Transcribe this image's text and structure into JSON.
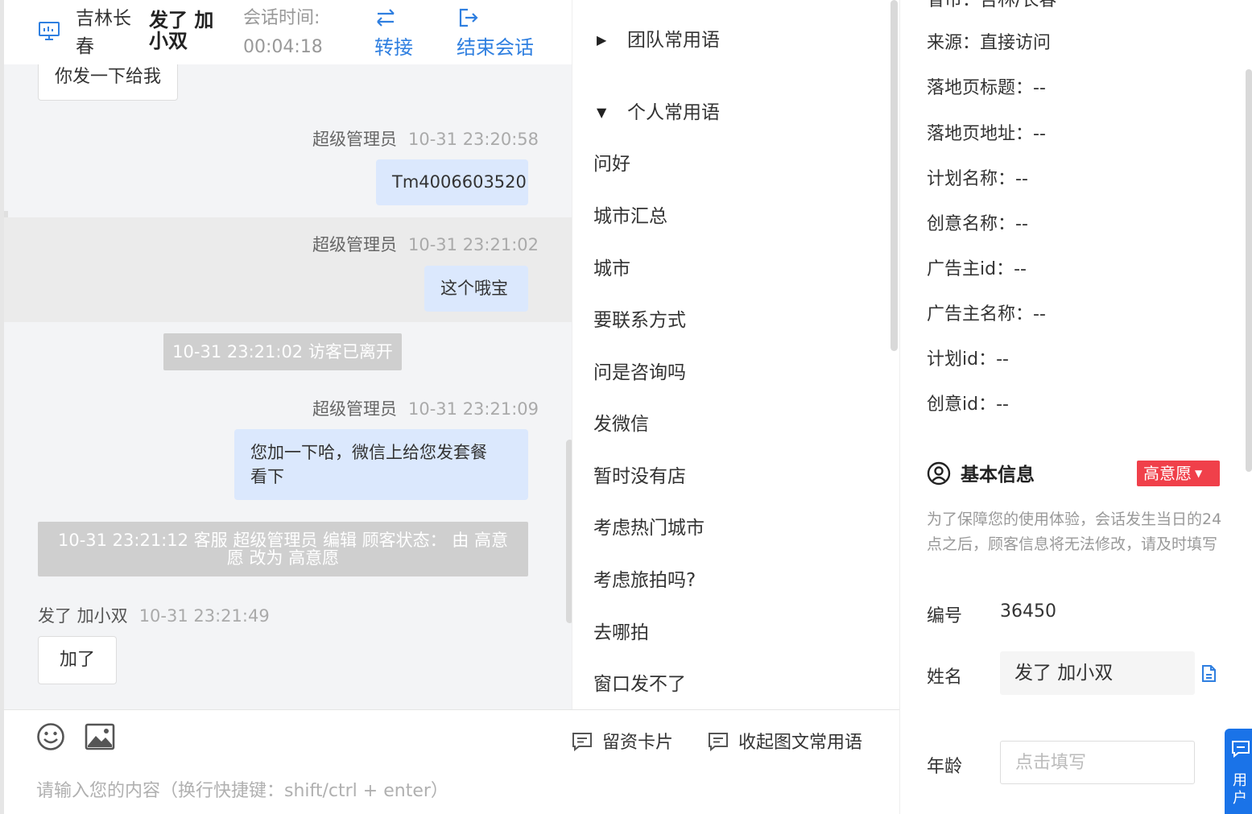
{
  "colors": {
    "accent": "#2f7fe0",
    "agent_bubble": "#dbe8fd",
    "badge_red": "#f0404a",
    "system_note": "#cfcfcf"
  },
  "header": {
    "location": "吉林长春",
    "visitor_name": "发了 加小双",
    "session_time_label": "会话时间:",
    "session_time": "00:04:18",
    "transfer_label": "转接",
    "end_label": "结束会话"
  },
  "messages": {
    "m0": {
      "text": "你发一下给我"
    },
    "m1": {
      "sender": "超级管理员",
      "time": "10-31 23:20:58",
      "text": "Tm4006603520"
    },
    "m2": {
      "sender": "超级管理员",
      "time": "10-31 23:21:02",
      "text": "这个哦宝"
    },
    "sys1": "10-31 23:21:02 访客已离开",
    "m3": {
      "sender": "超级管理员",
      "time": "10-31 23:21:09",
      "text_line1": "您加一下哈，微信上给您发套餐",
      "text_line2": "看下"
    },
    "sys2_line1": "10-31 23:21:12 客服 超级管理员 编辑 顾客状态： 由 高意",
    "sys2_line2": "愿 改为 高意愿",
    "m4": {
      "sender": "发了 加小双",
      "time": "10-31 23:21:49",
      "text": "加了"
    }
  },
  "input": {
    "card_label": "留资卡片",
    "fold_label": "收起图文常用语",
    "placeholder": "请输入您的内容（换行快捷键：shift/ctrl + enter）"
  },
  "phrases": {
    "team_group": "团队常用语",
    "personal_group": "个人常用语",
    "items": [
      "问好",
      "城市汇总",
      "城市",
      "要联系方式",
      "问是咨询吗",
      "发微信",
      "暂时没有店",
      "考虑热门城市",
      "考虑旅拍吗?",
      "去哪拍",
      "窗口发不了"
    ]
  },
  "info": {
    "partial_top": "省市：吉林/长春",
    "rows": [
      "来源：直接访问",
      "落地页标题：--",
      "落地页地址：--",
      "计划名称：--",
      "创意名称：--",
      "广告主id：--",
      "广告主名称：--",
      "计划id：--",
      "创意id：--"
    ],
    "basic_title": "基本信息",
    "intent_badge": "高意愿",
    "notice": "为了保障您的使用体验，会话发生当日的24点之后，顾客信息将无法修改，请及时填写",
    "id_label": "编号",
    "id_value": "36450",
    "name_label": "姓名",
    "name_value": "发了 加小双",
    "age_label": "年龄",
    "age_placeholder": "点击填写",
    "user_tab": "用户"
  }
}
